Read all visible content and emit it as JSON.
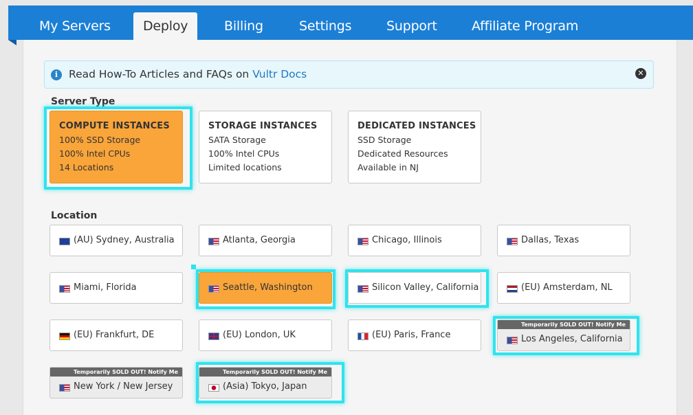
{
  "nav": {
    "tabs": [
      {
        "label": "My Servers"
      },
      {
        "label": "Deploy"
      },
      {
        "label": "Billing"
      },
      {
        "label": "Settings"
      },
      {
        "label": "Support"
      },
      {
        "label": "Affiliate Program"
      }
    ],
    "active_tab": "Deploy"
  },
  "info": {
    "text": "Read How-To Articles and FAQs on ",
    "link": "Vultr Docs"
  },
  "server_type": {
    "title": "Server Type",
    "cards": [
      {
        "title": "COMPUTE INSTANCES",
        "lines": [
          "100% SSD Storage",
          "100% Intel CPUs",
          "14 Locations"
        ],
        "selected": true
      },
      {
        "title": "STORAGE INSTANCES",
        "lines": [
          "SATA Storage",
          "100% Intel CPUs",
          "Limited locations"
        ],
        "selected": false
      },
      {
        "title": "DEDICATED INSTANCES",
        "lines": [
          "SSD Storage",
          "Dedicated Resources",
          "Available in NJ"
        ],
        "selected": false
      }
    ]
  },
  "location": {
    "title": "Location",
    "sold_out_label": "Temporarily SOLD OUT! Notify Me",
    "items": [
      {
        "label": "(AU) Sydney, Australia",
        "flag": "au",
        "selected": false,
        "sold_out": false
      },
      {
        "label": "Atlanta, Georgia",
        "flag": "us",
        "selected": false,
        "sold_out": false
      },
      {
        "label": "Chicago, Illinois",
        "flag": "us",
        "selected": false,
        "sold_out": false
      },
      {
        "label": "Dallas, Texas",
        "flag": "us",
        "selected": false,
        "sold_out": false
      },
      {
        "label": "Miami, Florida",
        "flag": "us",
        "selected": false,
        "sold_out": false
      },
      {
        "label": "Seattle, Washington",
        "flag": "us",
        "selected": true,
        "sold_out": false
      },
      {
        "label": "Silicon Valley, California",
        "flag": "us",
        "selected": false,
        "sold_out": false
      },
      {
        "label": "(EU) Amsterdam, NL",
        "flag": "nl",
        "selected": false,
        "sold_out": false
      },
      {
        "label": "(EU) Frankfurt, DE",
        "flag": "de",
        "selected": false,
        "sold_out": false
      },
      {
        "label": "(EU) London, UK",
        "flag": "gb",
        "selected": false,
        "sold_out": false
      },
      {
        "label": "(EU) Paris, France",
        "flag": "fr",
        "selected": false,
        "sold_out": false
      },
      {
        "label": "Los Angeles, California",
        "flag": "us",
        "selected": false,
        "sold_out": true
      },
      {
        "label": "New York / New Jersey",
        "flag": "us",
        "selected": false,
        "sold_out": true
      },
      {
        "label": "(Asia) Tokyo, Japan",
        "flag": "jp",
        "selected": false,
        "sold_out": true
      }
    ]
  },
  "colors": {
    "topbar": "#1b7fd6",
    "selected_card": "#faa53a",
    "highlight": "#30e3ed",
    "link": "#1f78c2"
  }
}
